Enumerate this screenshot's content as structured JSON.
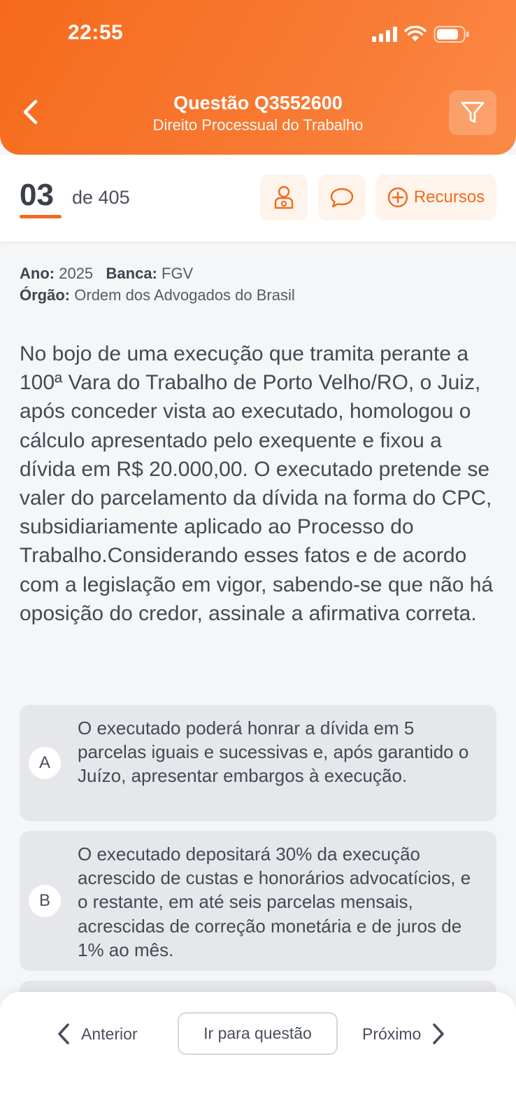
{
  "status_bar": {
    "time": "22:55"
  },
  "header": {
    "title": "Questão Q3552600",
    "subtitle": "Direito Processual do Trabalho",
    "accent_color": "#f66a1c",
    "icons": {
      "back": "chevron-left-icon",
      "filter": "filter-funnel-icon"
    }
  },
  "counter": {
    "current": "03",
    "total": "de 405",
    "actions": {
      "teacher_icon": "teacher-icon",
      "comments_icon": "comment-bubble-icon",
      "resources_label": "Recursos"
    }
  },
  "meta": {
    "year_label": "Ano:",
    "year": "2025",
    "board_label": "Banca:",
    "board": "FGV",
    "org_label": "Órgão:",
    "org": "Ordem dos Advogados do Brasil"
  },
  "question": {
    "text": "No bojo de uma execução que tramita perante a 100ª Vara do Trabalho de Porto Velho/RO, o Juiz, após conceder vista ao executado, homologou o cálculo apresentado pelo exequente e fixou a dívida em R$ 20.000,00. O executado pretende se valer do parcelamento da dívida na forma do CPC, subsidiariamente aplicado ao Processo do Trabalho.Considerando esses fatos e de acordo com a legislação em vigor, sabendo-se que não há oposição do credor, assinale a afirmativa correta."
  },
  "options": [
    {
      "letter": "A",
      "text": "O executado poderá honrar a dívida em 5 parcelas iguais e sucessivas e, após garantido o Juízo, apresentar embargos à execução."
    },
    {
      "letter": "B",
      "text": "O executado depositará 30% da execução acrescido de custas e honorários advocatícios, e o restante, em até seis parcelas mensais, acrescidas de correção monetária e de juros de 1% ao mês."
    }
  ],
  "bottom_nav": {
    "prev_label": "Anterior",
    "goto_label": "Ir para questão",
    "next_label": "Próximo"
  }
}
